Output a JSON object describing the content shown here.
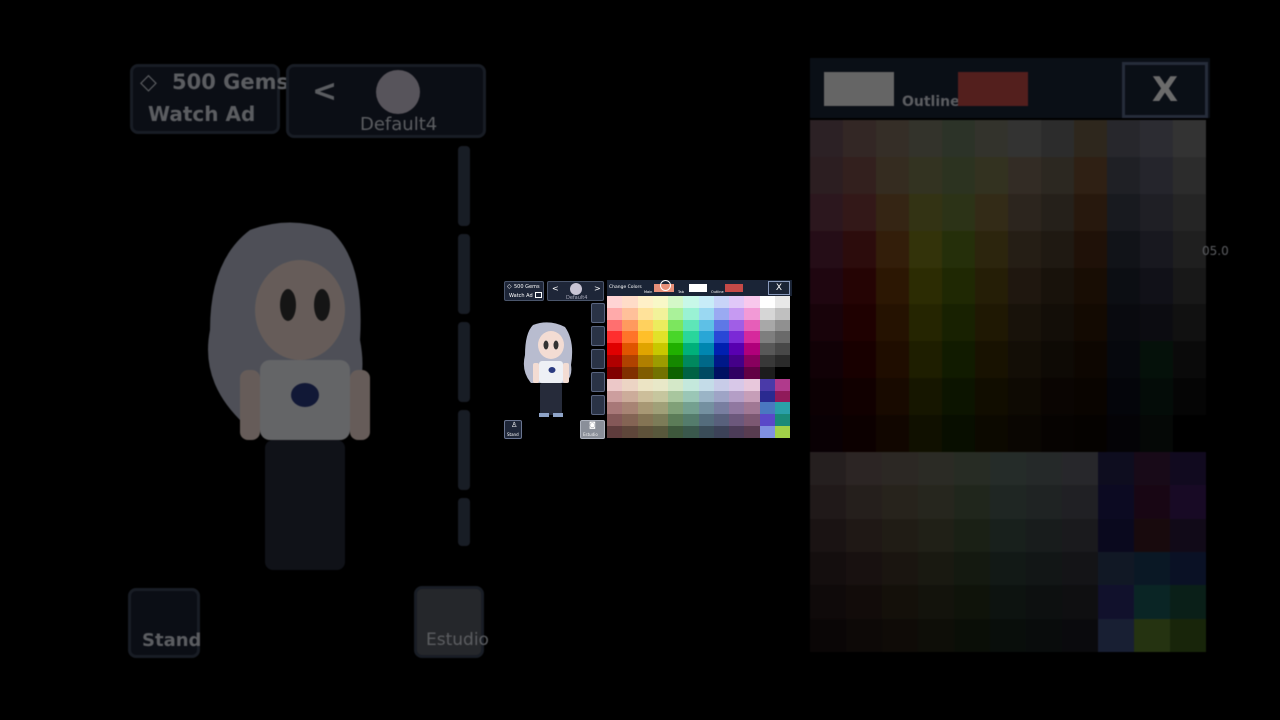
{
  "gems": {
    "count_label": "500 Gems",
    "watch_ad_label": "Watch Ad"
  },
  "character": {
    "preset_name": "Default4",
    "nav_prev": "<",
    "nav_next": ">"
  },
  "buttons": {
    "stand_label": "Stand",
    "studio_label": "Estudio"
  },
  "picker": {
    "title": "Change Colors",
    "main_label": "Main",
    "tab2_label": "Tab",
    "outline_label": "Outline",
    "close_label": "X",
    "main_color": "#e89079",
    "secondary_color": "#ffffff",
    "outline_color": "#c54a47",
    "side_value": "05.0"
  },
  "colors": {
    "panel_bg": "#1a2436",
    "panel_border": "#4a556b",
    "hair": "#b8bccf",
    "shirt": "#eef0f5",
    "pants": "#262b3a"
  },
  "palette_rows": [
    [
      "#ffd4d4",
      "#ffdcc8",
      "#fff0c8",
      "#f8f8c8",
      "#d4f8c8",
      "#c8f8e8",
      "#c8ecf8",
      "#c8d4f8",
      "#e0c8f8",
      "#f8c8ec",
      "#ffffff",
      "#e8e8e8"
    ],
    [
      "#ffaaaa",
      "#ffc09a",
      "#ffe29a",
      "#f2f29a",
      "#aaf29a",
      "#9af2d4",
      "#9ad8f2",
      "#9aaaf2",
      "#c69af2",
      "#f29ad6",
      "#d6d6d6",
      "#c0c0c0"
    ],
    [
      "#ff6f6f",
      "#ff9a5e",
      "#ffd15e",
      "#ecec5e",
      "#7ce65e",
      "#5ee6b8",
      "#5ec0e6",
      "#5e78e6",
      "#a05ee6",
      "#e65eb8",
      "#a8a8a8",
      "#909090"
    ],
    [
      "#ff2e2e",
      "#ff7429",
      "#ffbf29",
      "#e2e229",
      "#48d629",
      "#29d69c",
      "#29a6d6",
      "#2948d6",
      "#7b29d6",
      "#d6299c",
      "#7e7e7e",
      "#6a6a6a"
    ],
    [
      "#e00000",
      "#e05500",
      "#e0a400",
      "#c8c800",
      "#20b000",
      "#00b07a",
      "#0086b0",
      "#0020b0",
      "#5800b0",
      "#b0007a",
      "#585858",
      "#484848"
    ],
    [
      "#b00000",
      "#b04200",
      "#b07f00",
      "#9c9c00",
      "#158800",
      "#00885e",
      "#006888",
      "#001888",
      "#440088",
      "#88005e",
      "#383838",
      "#2a2a2a"
    ],
    [
      "#800000",
      "#802f00",
      "#805c00",
      "#727200",
      "#0e6200",
      "#006244",
      "#004a62",
      "#001062",
      "#300062",
      "#620044",
      "#1c1c1c",
      "#000000"
    ],
    [
      "#ecc8c8",
      "#ecd4c4",
      "#ece4c4",
      "#e8e8c8",
      "#d4e8c8",
      "#c4e8dc",
      "#c4dce8",
      "#c8cce8",
      "#d8c8e8",
      "#e8c8dc",
      "#4a3aa8",
      "#b03a8c"
    ],
    [
      "#cc9e9e",
      "#ccac9a",
      "#ccbe9a",
      "#c6c69e",
      "#a8c69e",
      "#9ac6b6",
      "#9ab4c6",
      "#9ea4c6",
      "#b49ec6",
      "#c69eb8",
      "#2a2a90",
      "#901a5a"
    ],
    [
      "#a87878",
      "#a88474",
      "#a89874",
      "#a0a078",
      "#80a078",
      "#74a090",
      "#7490a0",
      "#787ea0",
      "#9078a0",
      "#a07894",
      "#4a78c0",
      "#2aa0a8"
    ],
    [
      "#845858",
      "#846454",
      "#847454",
      "#7c7c58",
      "#5c7c58",
      "#547c6c",
      "#546c7c",
      "#58607c",
      "#6c587c",
      "#7c5872",
      "#5a48c8",
      "#1a8a78"
    ],
    [
      "#5e3c3c",
      "#5e463a",
      "#5e523a",
      "#58583c",
      "#3e583c",
      "#3a584c",
      "#3a4c58",
      "#3c4258",
      "#4c3c58",
      "#583c50",
      "#8090e0",
      "#a0d048"
    ]
  ],
  "bg_right_rows": [
    [
      "#6a5058",
      "#7a5e58",
      "#7e6e5e",
      "#7a7a66",
      "#6a7a60",
      "#7a7a6a",
      "#7a7a78",
      "#6a6a6a",
      "#6e5e46",
      "#5e5e6a",
      "#6a6a78",
      "#7a7a7a"
    ],
    [
      "#6a4850",
      "#7a4c48",
      "#7e6a4c",
      "#7a7a50",
      "#6a7a4c",
      "#7a784c",
      "#7a6a58",
      "#6a6050",
      "#704c30",
      "#4a4e5a",
      "#5a5a6a",
      "#6a6a6a"
    ],
    [
      "#6a3848",
      "#7a3a3a",
      "#7e5a30",
      "#7a7a30",
      "#6a7a38",
      "#7a6838",
      "#6a5848",
      "#5a4e3e",
      "#5e3a20",
      "#3a3e4a",
      "#4a4a5a",
      "#5a5a5a"
    ],
    [
      "#5a2038",
      "#6a1e1e",
      "#7a4818",
      "#7a7a18",
      "#5a7018",
      "#6a5820",
      "#5a4834",
      "#4a3c2c",
      "#4a2a14",
      "#2a2e3a",
      "#3a3a4a",
      "#4a4a4a"
    ],
    [
      "#4a1028",
      "#5a0a0a",
      "#6a3808",
      "#6a6a08",
      "#4a6008",
      "#5a4810",
      "#4a3824",
      "#3a2c1c",
      "#3a200a",
      "#1e222e",
      "#2a2a3a",
      "#3a3a3a"
    ],
    [
      "#3a0818",
      "#4a0404",
      "#5a2c04",
      "#5a5a04",
      "#3a5004",
      "#4a3a08",
      "#3a2c18",
      "#2e2214",
      "#2e1806",
      "#161a24",
      "#1e1e2a",
      "#2a2a2a"
    ],
    [
      "#2a0410",
      "#3a0202",
      "#4a2002",
      "#484802",
      "#2a4002",
      "#3a2c04",
      "#2e2210",
      "#22180c",
      "#201004",
      "#101420",
      "#0e2a18",
      "#1a1a1a"
    ],
    [
      "#1e0208",
      "#2a0000",
      "#3a1800",
      "#363600",
      "#1e3000",
      "#2a2000",
      "#221808",
      "#180e06",
      "#160a02",
      "#0a0c18",
      "#0a1e14",
      "#0e0e0e"
    ],
    [
      "#16020a",
      "#1e0000",
      "#2a1000",
      "#262600",
      "#142200",
      "#1e1600",
      "#181006",
      "#100804",
      "#0e0602",
      "#0a0810",
      "#0c1410",
      "#000000"
    ]
  ],
  "bg_right_bottom_rows": [
    [
      "#5a4a4a",
      "#6a5a56",
      "#6a6056",
      "#686858",
      "#5e6a56",
      "#5a6a62",
      "#5a6262",
      "#5e5e66",
      "#22204a",
      "#3a1a3a",
      "#2a1a4a"
    ],
    [
      "#4e3c3c",
      "#5a4a44",
      "#5e5444",
      "#5c5c48",
      "#4e5c44",
      "#4a5c54",
      "#4a5454",
      "#4e4e56",
      "#1e1a52",
      "#3a1030",
      "#3a1a5a"
    ],
    [
      "#3e2e2e",
      "#4a3a34",
      "#4e4434",
      "#4c4c38",
      "#3e4c34",
      "#3a4c44",
      "#3a4444",
      "#3e3e46",
      "#1a1648",
      "#3a1a20",
      "#2a1a3a"
    ],
    [
      "#302222",
      "#3a2a26",
      "#3e3426",
      "#3c3c2a",
      "#303c26",
      "#2c3c36",
      "#2c3636",
      "#303038",
      "#2a3a5a",
      "#1a3a5a",
      "#1a2a5a"
    ],
    [
      "#241818",
      "#2c1e1a",
      "#30281a",
      "#2e2e1e",
      "#242e1a",
      "#202e28",
      "#202828",
      "#24242a",
      "#2a2a6a",
      "#1a5a5a",
      "#1a4a3a"
    ],
    [
      "#1a1010",
      "#201612",
      "#241c12",
      "#222214",
      "#1a2212",
      "#16221c",
      "#161e1e",
      "#1a1a20",
      "#3a4a7a",
      "#5a7a2a",
      "#3a5a1a"
    ]
  ]
}
